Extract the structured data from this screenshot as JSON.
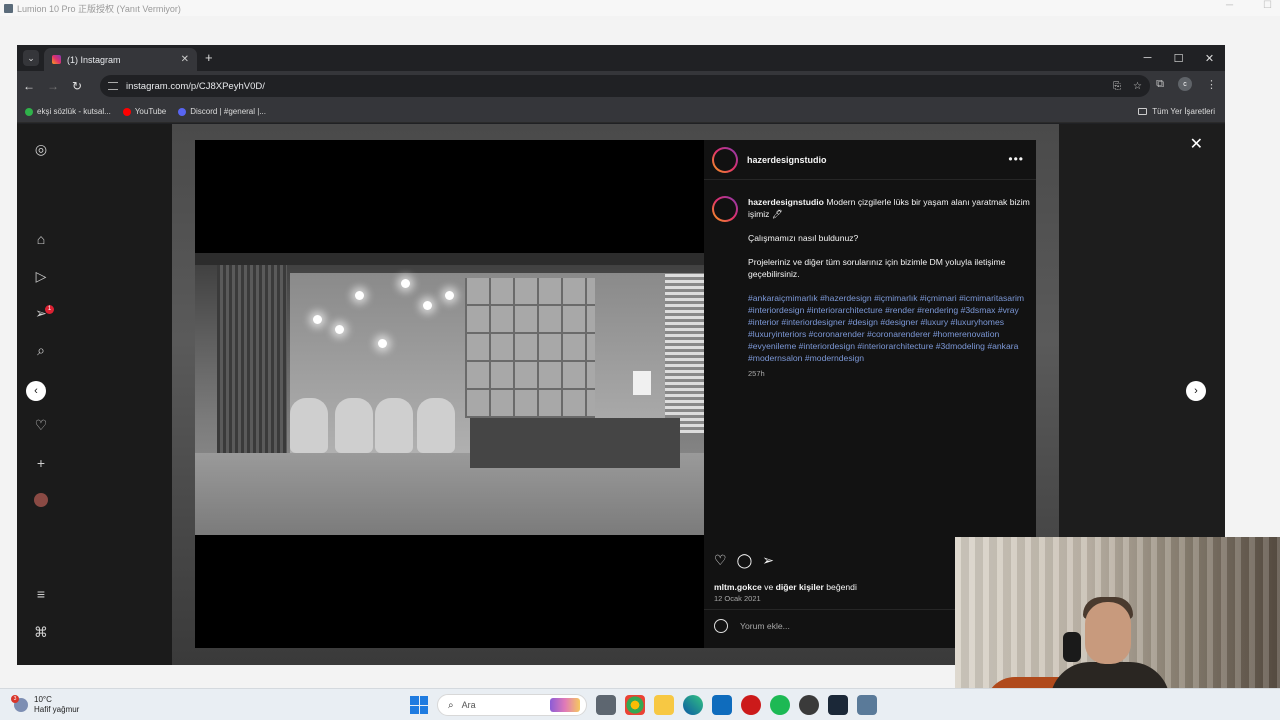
{
  "app_window": {
    "title": "Lumion 10 Pro 正版授权 (Yanıt Vermiyor)"
  },
  "browser": {
    "tab_title": "(1) Instagram",
    "url": "instagram.com/p/CJ8XPeyhV0D/",
    "bookmarks": [
      {
        "label": "ekşi sözlük - kutsal...",
        "color": "#2fb24a"
      },
      {
        "label": "YouTube",
        "color": "#ff0000"
      },
      {
        "label": "Discord | #general |...",
        "color": "#5865f2"
      }
    ],
    "all_bookmarks_label": "Tüm Yer İşaretleri"
  },
  "post": {
    "author": "hazerdesignstudio",
    "caption_line1": "Modern çizgilerle lüks bir yaşam alanı yaratmak bizim işimiz 🖊",
    "caption_question": "Çalışmamızı nasıl buldunuz?",
    "caption_contact": "Projeleriniz ve diğer tüm sorularınız için bizimle DM yoluyla iletişime geçebilirsiniz.",
    "hashtags": "#ankaraiçmimarlık #hazerdesign #içmimarlık #içmimari #icmimaritasarim #interiordesign #interiorarchitecture #render #rendering #3dsmax #vray #interior #interiordesigner #design #designer #luxury #luxuryhomes #luxuryinteriors #coronarender #coronarenderer #homerenovation #evyenileme #interiordesign #interiorarchitecture #3dmodeling #ankara #modernsalon #moderndesign",
    "time_ago": "257h",
    "likes_user": "mltm.gokce",
    "likes_connector": "ve",
    "likes_others": "diğer kişiler",
    "likes_verb": "beğendi",
    "date": "12 Ocak 2021",
    "comment_placeholder": "Yorum ekle...",
    "notification_badge": "1"
  },
  "taskbar": {
    "weather_temp": "10°C",
    "weather_desc": "Hafif yağmur",
    "weather_badge": "3",
    "search_placeholder": "Ara"
  },
  "colors": {
    "instagram_link": "#7c98d7",
    "browser_dark": "#202124",
    "taskbar_bg": "#e9eef3"
  }
}
